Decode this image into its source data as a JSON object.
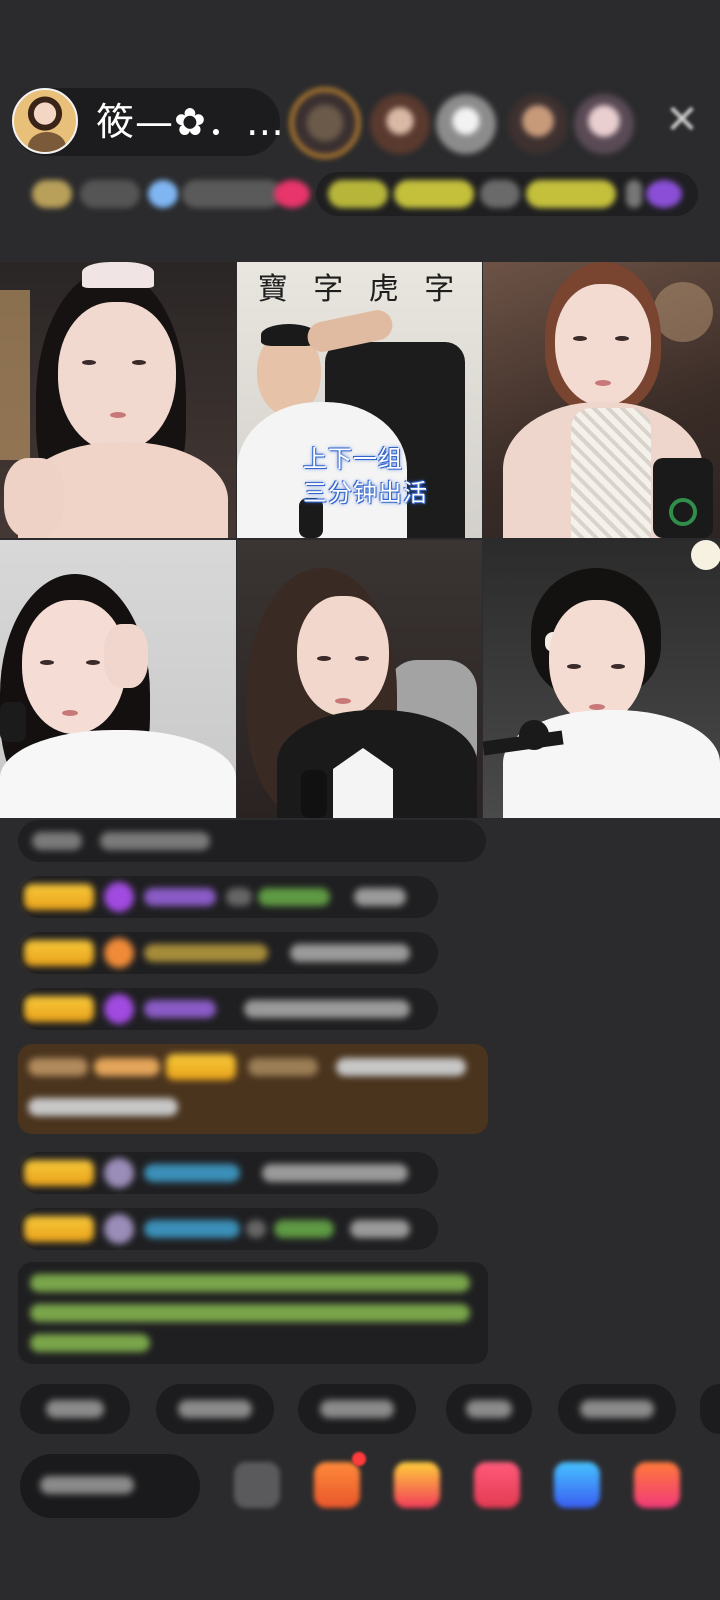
{
  "host": {
    "name": "筱—✿．…"
  },
  "stream": {
    "caption_line1": "上下一组",
    "caption_line2": "三分钟出活",
    "calligraphy": [
      "寶",
      "字",
      "虎",
      "字"
    ]
  },
  "colors": {
    "background": "#2b2b2d",
    "badge_gold": "#f0b022",
    "user_purple": "#9b5de5",
    "user_cyan": "#4fb3d9",
    "system_green": "#a6d36b",
    "gift_card_brown": "#5a3a1a",
    "caption_blue": "#3a6ed6"
  },
  "icons": {
    "close": "close-icon",
    "notification_dot": "red-dot"
  }
}
